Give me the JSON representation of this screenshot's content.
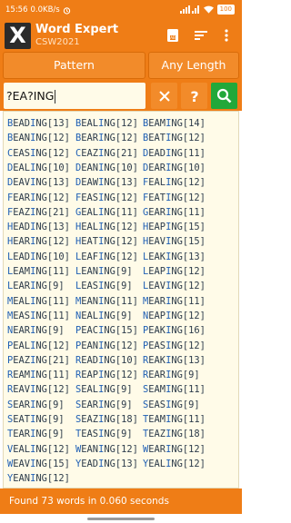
{
  "status": {
    "time": "15:56",
    "speed": "0.0KB/s",
    "battery": "100"
  },
  "app": {
    "logo": "X",
    "title": "Word Expert",
    "subtitle": "CSW2021"
  },
  "modes": {
    "pattern": "Pattern",
    "length": "Any Length"
  },
  "search": {
    "query": "?EA?ING"
  },
  "words": [
    {
      "w": "BEADING",
      "s": "[13]",
      "b": [
        0,
        4
      ]
    },
    {
      "w": "BEALING",
      "s": "[12]",
      "b": [
        0,
        4
      ]
    },
    {
      "w": "BEAMING",
      "s": "[14]",
      "b": [
        0,
        4
      ]
    },
    {
      "w": "BEANING",
      "s": "[12]",
      "b": [
        0,
        4
      ]
    },
    {
      "w": "BEARING",
      "s": "[12]",
      "b": [
        0,
        4
      ]
    },
    {
      "w": "BEATING",
      "s": "[12]",
      "b": [
        0,
        4
      ]
    },
    {
      "w": "CEASING",
      "s": "[12]",
      "b": [
        0,
        4
      ]
    },
    {
      "w": "CEAZING",
      "s": "[21]",
      "b": [
        0,
        4
      ]
    },
    {
      "w": "DEADING",
      "s": "[11]",
      "b": [
        0,
        4
      ]
    },
    {
      "w": "DEALING",
      "s": "[10]",
      "b": [
        0,
        4
      ]
    },
    {
      "w": "DEANING",
      "s": "[10]",
      "b": [
        0,
        4
      ]
    },
    {
      "w": "DEARING",
      "s": "[10]",
      "b": [
        0,
        4
      ]
    },
    {
      "w": "DEAVING",
      "s": "[13]",
      "b": [
        0,
        4
      ]
    },
    {
      "w": "DEAWING",
      "s": "[13]",
      "b": [
        0,
        4
      ]
    },
    {
      "w": "FEALING",
      "s": "[12]",
      "b": [
        0,
        4
      ]
    },
    {
      "w": "FEARING",
      "s": "[12]",
      "b": [
        0,
        4
      ]
    },
    {
      "w": "FEASING",
      "s": "[12]",
      "b": [
        0,
        4
      ]
    },
    {
      "w": "FEATING",
      "s": "[12]",
      "b": [
        0,
        4
      ]
    },
    {
      "w": "FEAZING",
      "s": "[21]",
      "b": [
        0,
        4
      ]
    },
    {
      "w": "GEALING",
      "s": "[11]",
      "b": [
        0,
        4
      ]
    },
    {
      "w": "GEARING",
      "s": "[11]",
      "b": [
        0,
        4
      ]
    },
    {
      "w": "HEADING",
      "s": "[13]",
      "b": [
        0,
        4
      ]
    },
    {
      "w": "HEALING",
      "s": "[12]",
      "b": [
        0,
        4
      ]
    },
    {
      "w": "HEAPING",
      "s": "[15]",
      "b": [
        0,
        4
      ]
    },
    {
      "w": "HEARING",
      "s": "[12]",
      "b": [
        0,
        4
      ]
    },
    {
      "w": "HEATING",
      "s": "[12]",
      "b": [
        0,
        4
      ]
    },
    {
      "w": "HEAVING",
      "s": "[15]",
      "b": [
        0,
        4
      ]
    },
    {
      "w": "LEADING",
      "s": "[10]",
      "b": [
        0,
        4
      ]
    },
    {
      "w": "LEAFING",
      "s": "[12]",
      "b": [
        0,
        4
      ]
    },
    {
      "w": "LEAKING",
      "s": "[13]",
      "b": [
        0,
        4
      ]
    },
    {
      "w": "LEAMING",
      "s": "[11]",
      "b": [
        0,
        4
      ]
    },
    {
      "w": "LEANING",
      "s": "[9]",
      "b": [
        0,
        4
      ]
    },
    {
      "w": "LEAPING",
      "s": "[12]",
      "b": [
        0,
        4
      ]
    },
    {
      "w": "LEARING",
      "s": "[9]",
      "b": [
        0,
        4
      ]
    },
    {
      "w": "LEASING",
      "s": "[9]",
      "b": [
        0,
        4
      ]
    },
    {
      "w": "LEAVING",
      "s": "[12]",
      "b": [
        0,
        4
      ]
    },
    {
      "w": "MEALING",
      "s": "[11]",
      "b": [
        0,
        4
      ]
    },
    {
      "w": "MEANING",
      "s": "[11]",
      "b": [
        0,
        4
      ]
    },
    {
      "w": "MEARING",
      "s": "[11]",
      "b": [
        0,
        4
      ]
    },
    {
      "w": "MEASING",
      "s": "[11]",
      "b": [
        0,
        4
      ]
    },
    {
      "w": "NEALING",
      "s": "[9]",
      "b": [
        0,
        4
      ]
    },
    {
      "w": "NEAPING",
      "s": "[12]",
      "b": [
        0,
        4
      ]
    },
    {
      "w": "NEARING",
      "s": "[9]",
      "b": [
        0,
        4
      ]
    },
    {
      "w": "PEACING",
      "s": "[15]",
      "b": [
        0,
        4
      ]
    },
    {
      "w": "PEAKING",
      "s": "[16]",
      "b": [
        0,
        4
      ]
    },
    {
      "w": "PEALING",
      "s": "[12]",
      "b": [
        0,
        4
      ]
    },
    {
      "w": "PEANING",
      "s": "[12]",
      "b": [
        0,
        4
      ]
    },
    {
      "w": "PEASING",
      "s": "[12]",
      "b": [
        0,
        4
      ]
    },
    {
      "w": "PEAZING",
      "s": "[21]",
      "b": [
        0,
        4
      ]
    },
    {
      "w": "READING",
      "s": "[10]",
      "b": [
        0,
        4
      ]
    },
    {
      "w": "REAKING",
      "s": "[13]",
      "b": [
        0,
        4
      ]
    },
    {
      "w": "REAMING",
      "s": "[11]",
      "b": [
        0,
        4
      ]
    },
    {
      "w": "REAPING",
      "s": "[12]",
      "b": [
        0,
        4
      ]
    },
    {
      "w": "REARING",
      "s": "[9]",
      "b": [
        0,
        4
      ]
    },
    {
      "w": "REAVING",
      "s": "[12]",
      "b": [
        0,
        4
      ]
    },
    {
      "w": "SEALING",
      "s": "[9]",
      "b": [
        0,
        4
      ]
    },
    {
      "w": "SEAMING",
      "s": "[11]",
      "b": [
        0,
        4
      ]
    },
    {
      "w": "SEARING",
      "s": "[9]",
      "b": [
        0,
        4
      ]
    },
    {
      "w": "SEARING",
      "s": "[9]",
      "b": [
        0,
        4
      ]
    },
    {
      "w": "SEASING",
      "s": "[9]",
      "b": [
        0,
        4
      ]
    },
    {
      "w": "SEATING",
      "s": "[9]",
      "b": [
        0,
        4
      ]
    },
    {
      "w": "SEAZING",
      "s": "[18]",
      "b": [
        0,
        4
      ]
    },
    {
      "w": "TEAMING",
      "s": "[11]",
      "b": [
        0,
        4
      ]
    },
    {
      "w": "TEARING",
      "s": "[9]",
      "b": [
        0,
        4
      ]
    },
    {
      "w": "TEASING",
      "s": "[9]",
      "b": [
        0,
        4
      ]
    },
    {
      "w": "TEAZING",
      "s": "[18]",
      "b": [
        0,
        4
      ]
    },
    {
      "w": "VEALING",
      "s": "[12]",
      "b": [
        0,
        4
      ]
    },
    {
      "w": "WEANING",
      "s": "[12]",
      "b": [
        0,
        4
      ]
    },
    {
      "w": "WEARING",
      "s": "[12]",
      "b": [
        0,
        4
      ]
    },
    {
      "w": "WEAVING",
      "s": "[15]",
      "b": [
        0,
        4
      ]
    },
    {
      "w": "YEADING",
      "s": "[13]",
      "b": [
        0,
        4
      ]
    },
    {
      "w": "YEALING",
      "s": "[12]",
      "b": [
        0,
        4
      ]
    },
    {
      "w": "YEANING",
      "s": "[12]",
      "b": [
        0,
        4
      ]
    }
  ],
  "footer": {
    "text": "Found 73 words in 0.060 seconds"
  },
  "colors": {
    "accent": "#ef7d16",
    "results_bg": "#fffbe8",
    "search_green": "#22a83a",
    "blank_letter": "#1f5fb4"
  }
}
